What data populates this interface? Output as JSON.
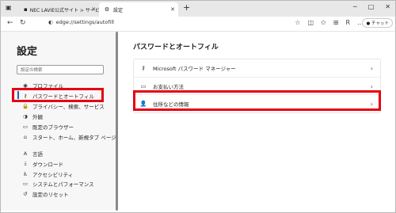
{
  "tabs": [
    {
      "label": "NEC LAVIE公式サイト > サービス&サ…",
      "icon": "page-icon"
    },
    {
      "label": "設定",
      "icon": "gear-icon"
    }
  ],
  "address": {
    "url": "edge://settings/autofill",
    "edge_label": "Edge"
  },
  "toolbar": {
    "chat_label": "チャット",
    "profile_initial": "R"
  },
  "sidebar": {
    "title": "設定",
    "search_placeholder": "設定の検索",
    "items": [
      {
        "label": "プロファイル",
        "icon": "profile-icon"
      },
      {
        "label": "パスワードとオートフィル",
        "icon": "key-icon",
        "selected": true
      },
      {
        "label": "プライバシー、検索、サービス",
        "icon": "lock-icon"
      },
      {
        "label": "外観",
        "icon": "appearance-icon"
      },
      {
        "label": "既定のブラウザー",
        "icon": "browser-icon"
      },
      {
        "label": "スタート、ホーム、新規タブ ページ",
        "icon": "home-icon"
      },
      {
        "label": "言語",
        "icon": "language-icon"
      },
      {
        "label": "ダウンロード",
        "icon": "download-icon"
      },
      {
        "label": "アクセシビリティ",
        "icon": "accessibility-icon"
      },
      {
        "label": "システムとパフォーマンス",
        "icon": "system-icon"
      },
      {
        "label": "設定のリセット",
        "icon": "reset-icon"
      }
    ]
  },
  "main": {
    "title": "パスワードとオートフィル",
    "rows": [
      {
        "label": "Microsoft パスワード マネージャー",
        "icon": "key-icon"
      },
      {
        "label": "お支払い方法",
        "icon": "card-icon"
      },
      {
        "label": "住所などの情報",
        "icon": "contact-icon"
      }
    ]
  },
  "colors": {
    "highlight": "#e60012",
    "accent": "#0f6cbd"
  }
}
